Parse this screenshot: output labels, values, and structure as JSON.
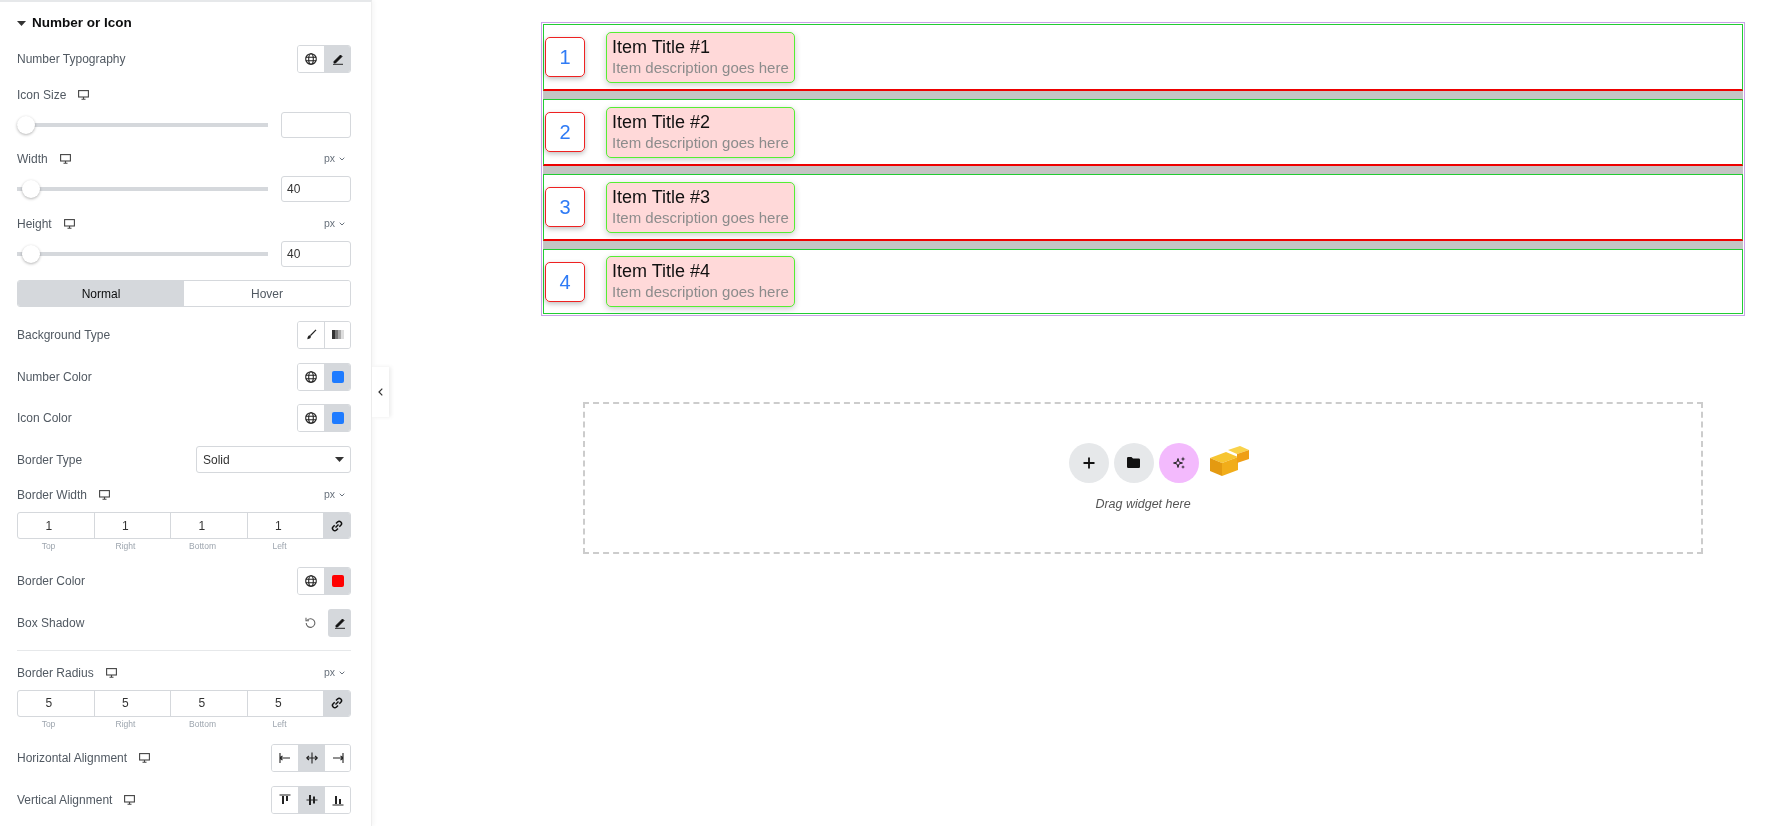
{
  "section": {
    "title": "Number or Icon",
    "expanded": true
  },
  "controls": [
    {
      "kind": "typography",
      "label": "Number Typography",
      "buttons": [
        {
          "selected": false
        },
        {
          "selected": true
        }
      ]
    },
    {
      "kind": "slider",
      "label": "Icon Size",
      "responsive": true,
      "level": 0
    },
    {
      "kind": "slider",
      "label": "Width",
      "responsive": true,
      "unit": "px",
      "level": 0.02,
      "value": "40"
    },
    {
      "kind": "slider",
      "label": "Height",
      "responsive": true,
      "unit": "px",
      "level": 0.02,
      "value": "40"
    },
    {
      "kind": "tabs",
      "tabs": [
        {
          "label": "Normal",
          "selected": true
        },
        {
          "label": "Hover",
          "selected": false
        }
      ]
    },
    {
      "kind": "background-type",
      "label": "Background Type",
      "buttons": [
        {
          "selected": false
        },
        {
          "selected": false
        }
      ]
    },
    {
      "kind": "color",
      "label": "Number Color",
      "color": "#1e7bff"
    },
    {
      "kind": "color",
      "label": "Icon Color",
      "color": "#1e7bff"
    },
    {
      "kind": "select",
      "label": "Border Type",
      "value": "Solid"
    },
    {
      "kind": "dimensions",
      "label": "Border Width",
      "responsive": true,
      "unit": "px",
      "linked": true,
      "fields": [
        {
          "value": "1",
          "side": "Top"
        },
        {
          "value": "1",
          "side": "Right"
        },
        {
          "value": "1",
          "side": "Bottom"
        },
        {
          "value": "1",
          "side": "Left"
        }
      ]
    },
    {
      "kind": "color",
      "label": "Border Color",
      "color": "#ff0000"
    },
    {
      "kind": "shadow",
      "label": "Box Shadow",
      "selected": true
    },
    {
      "kind": "divider"
    },
    {
      "kind": "dimensions",
      "label": "Border Radius",
      "responsive": true,
      "unit": "px",
      "linked": true,
      "fields": [
        {
          "value": "5",
          "side": "Top"
        },
        {
          "value": "5",
          "side": "Right"
        },
        {
          "value": "5",
          "side": "Bottom"
        },
        {
          "value": "5",
          "side": "Left"
        }
      ]
    },
    {
      "kind": "h-align",
      "label": "Horizontal Alignment",
      "responsive": true,
      "options": [
        {
          "selected": false
        },
        {
          "selected": true
        },
        {
          "selected": false
        }
      ]
    },
    {
      "kind": "v-align",
      "label": "Vertical Alignment",
      "responsive": true,
      "options": [
        {
          "selected": false
        },
        {
          "selected": true
        },
        {
          "selected": false
        }
      ]
    }
  ],
  "items": [
    {
      "number": "1",
      "title": "Item Title #1",
      "description": "Item description goes here"
    },
    {
      "number": "2",
      "title": "Item Title #2",
      "description": "Item description goes here"
    },
    {
      "number": "3",
      "title": "Item Title #3",
      "description": "Item description goes here"
    },
    {
      "number": "4",
      "title": "Item Title #4",
      "description": "Item description goes here"
    }
  ],
  "drop_zone": {
    "text": "Drag widget here"
  }
}
